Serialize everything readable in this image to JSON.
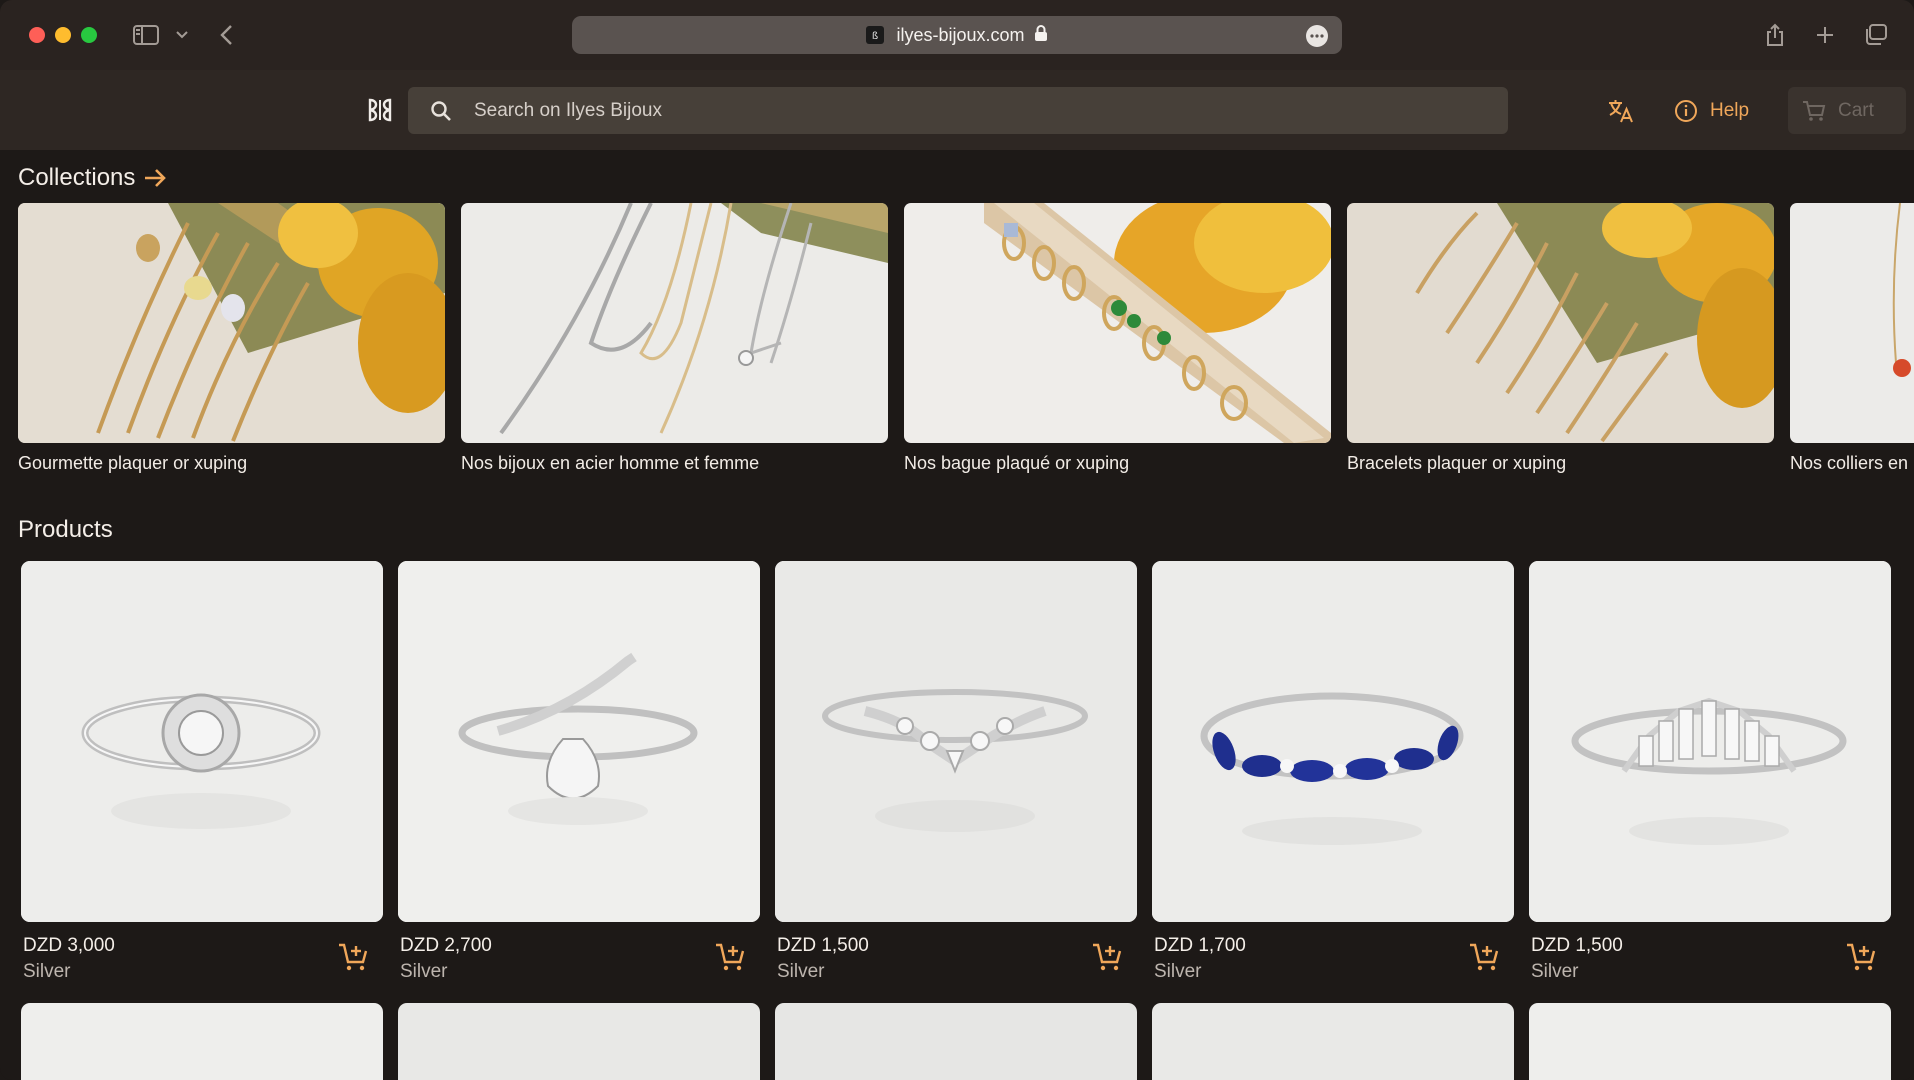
{
  "browser": {
    "url": "ilyes-bijoux.com"
  },
  "header": {
    "search_placeholder": "Search on Ilyes Bijoux",
    "help_label": "Help",
    "cart_label": "Cart"
  },
  "collections": {
    "title": "Collections",
    "items": [
      {
        "label": "Gourmette plaquer or xuping"
      },
      {
        "label": "Nos bijoux en acier homme et femme"
      },
      {
        "label": "Nos bague plaqué or xuping"
      },
      {
        "label": "Bracelets plaquer or xuping"
      },
      {
        "label": "Nos colliers en"
      }
    ]
  },
  "products": {
    "title": "Products",
    "items": [
      {
        "price": "DZD 3,000",
        "material": "Silver"
      },
      {
        "price": "DZD 2,700",
        "material": "Silver"
      },
      {
        "price": "DZD 1,500",
        "material": "Silver"
      },
      {
        "price": "DZD 1,700",
        "material": "Silver"
      },
      {
        "price": "DZD 1,500",
        "material": "Silver"
      }
    ]
  },
  "colors": {
    "accent": "#f0a75a",
    "background": "#1d1917",
    "header": "#2e2723"
  }
}
